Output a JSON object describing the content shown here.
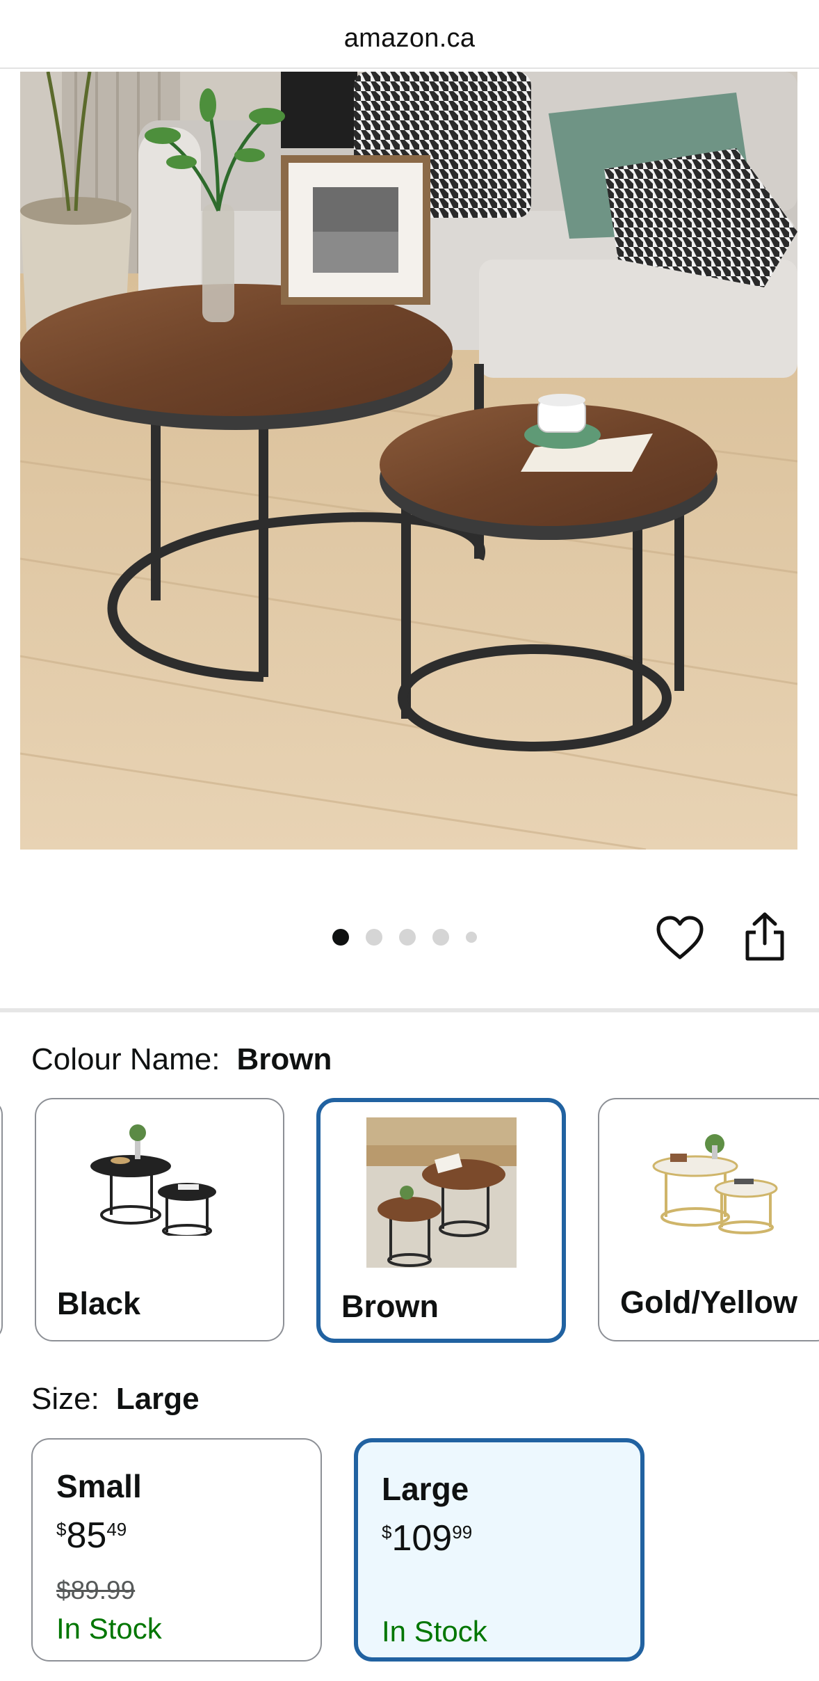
{
  "browser": {
    "url": "amazon.ca"
  },
  "gallery": {
    "image_count": 5,
    "active_index": 0
  },
  "colour": {
    "label": "Colour Name:",
    "selected": "Brown",
    "options": [
      {
        "name": "Black"
      },
      {
        "name": "Brown"
      },
      {
        "name": "Gold/Yellow"
      }
    ]
  },
  "size": {
    "label": "Size:",
    "selected": "Large",
    "options": [
      {
        "name": "Small",
        "currency": "$",
        "whole": "85",
        "fraction": "49",
        "was": "$89.99",
        "stock": "In Stock"
      },
      {
        "name": "Large",
        "currency": "$",
        "whole": "109",
        "fraction": "99",
        "stock": "In Stock"
      }
    ]
  },
  "colors": {
    "accent": "#2162a1",
    "selected_bg": "#edf8fe",
    "in_stock": "#007600"
  }
}
